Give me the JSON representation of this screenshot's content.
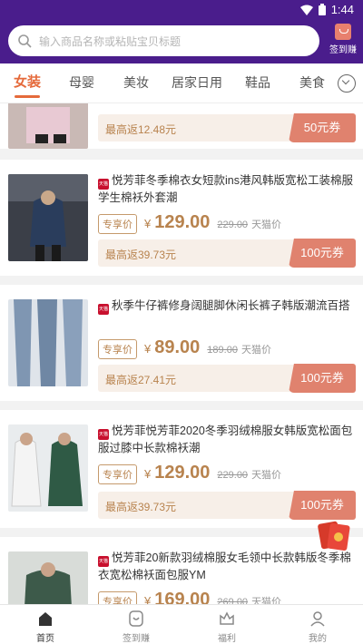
{
  "status": {
    "time": "1:44"
  },
  "search": {
    "placeholder": "输入商品名称或粘贴宝贝标题"
  },
  "checkin": {
    "label": "签到赚"
  },
  "tabs": [
    {
      "label": "女装"
    },
    {
      "label": "母婴"
    },
    {
      "label": "美妆"
    },
    {
      "label": "居家日用"
    },
    {
      "label": "鞋品"
    },
    {
      "label": "美食"
    }
  ],
  "products": [
    {
      "title": "",
      "price": "",
      "original": "",
      "shop": "",
      "tag": "",
      "rebate": "最高返12.48元",
      "coupon": "50元券"
    },
    {
      "title": "悦芳菲冬季棉衣女短款ins港风韩版宽松工装棉服学生棉袄外套潮",
      "tag": "专享价",
      "currency": "¥",
      "price": "129.00",
      "original": "229.00",
      "shop": "天猫价",
      "rebate": "最高返39.73元",
      "coupon": "100元券",
      "platform": "天猫"
    },
    {
      "title": "秋季牛仔裤修身阔腿脚休闲长裤子韩版潮流百搭",
      "tag": "专享价",
      "currency": "¥",
      "price": "89.00",
      "original": "189.00",
      "shop": "天猫价",
      "rebate": "最高返27.41元",
      "coupon": "100元券",
      "platform": "天猫"
    },
    {
      "title": "悦芳菲悦芳菲2020冬季羽绒棉服女韩版宽松面包服过膝中长款棉袄潮",
      "tag": "专享价",
      "currency": "¥",
      "price": "129.00",
      "original": "229.00",
      "shop": "天猫价",
      "rebate": "最高返39.73元",
      "coupon": "100元券",
      "platform": "天猫"
    },
    {
      "title": "悦芳菲20新款羽绒棉服女毛领中长款韩版冬季棉衣宽松棉袄面包服YM",
      "tag": "专享价",
      "currency": "¥",
      "price": "169.00",
      "original": "269.00",
      "shop": "天猫价",
      "platform": "天猫"
    }
  ],
  "bottom_nav": [
    {
      "label": "首页"
    },
    {
      "label": "签到赚"
    },
    {
      "label": "福利"
    },
    {
      "label": "我的"
    }
  ],
  "colors": {
    "brand": "#4a1d8c",
    "accent": "#e56a3b",
    "coupon": "#e0826e",
    "gold": "#b8834e"
  }
}
